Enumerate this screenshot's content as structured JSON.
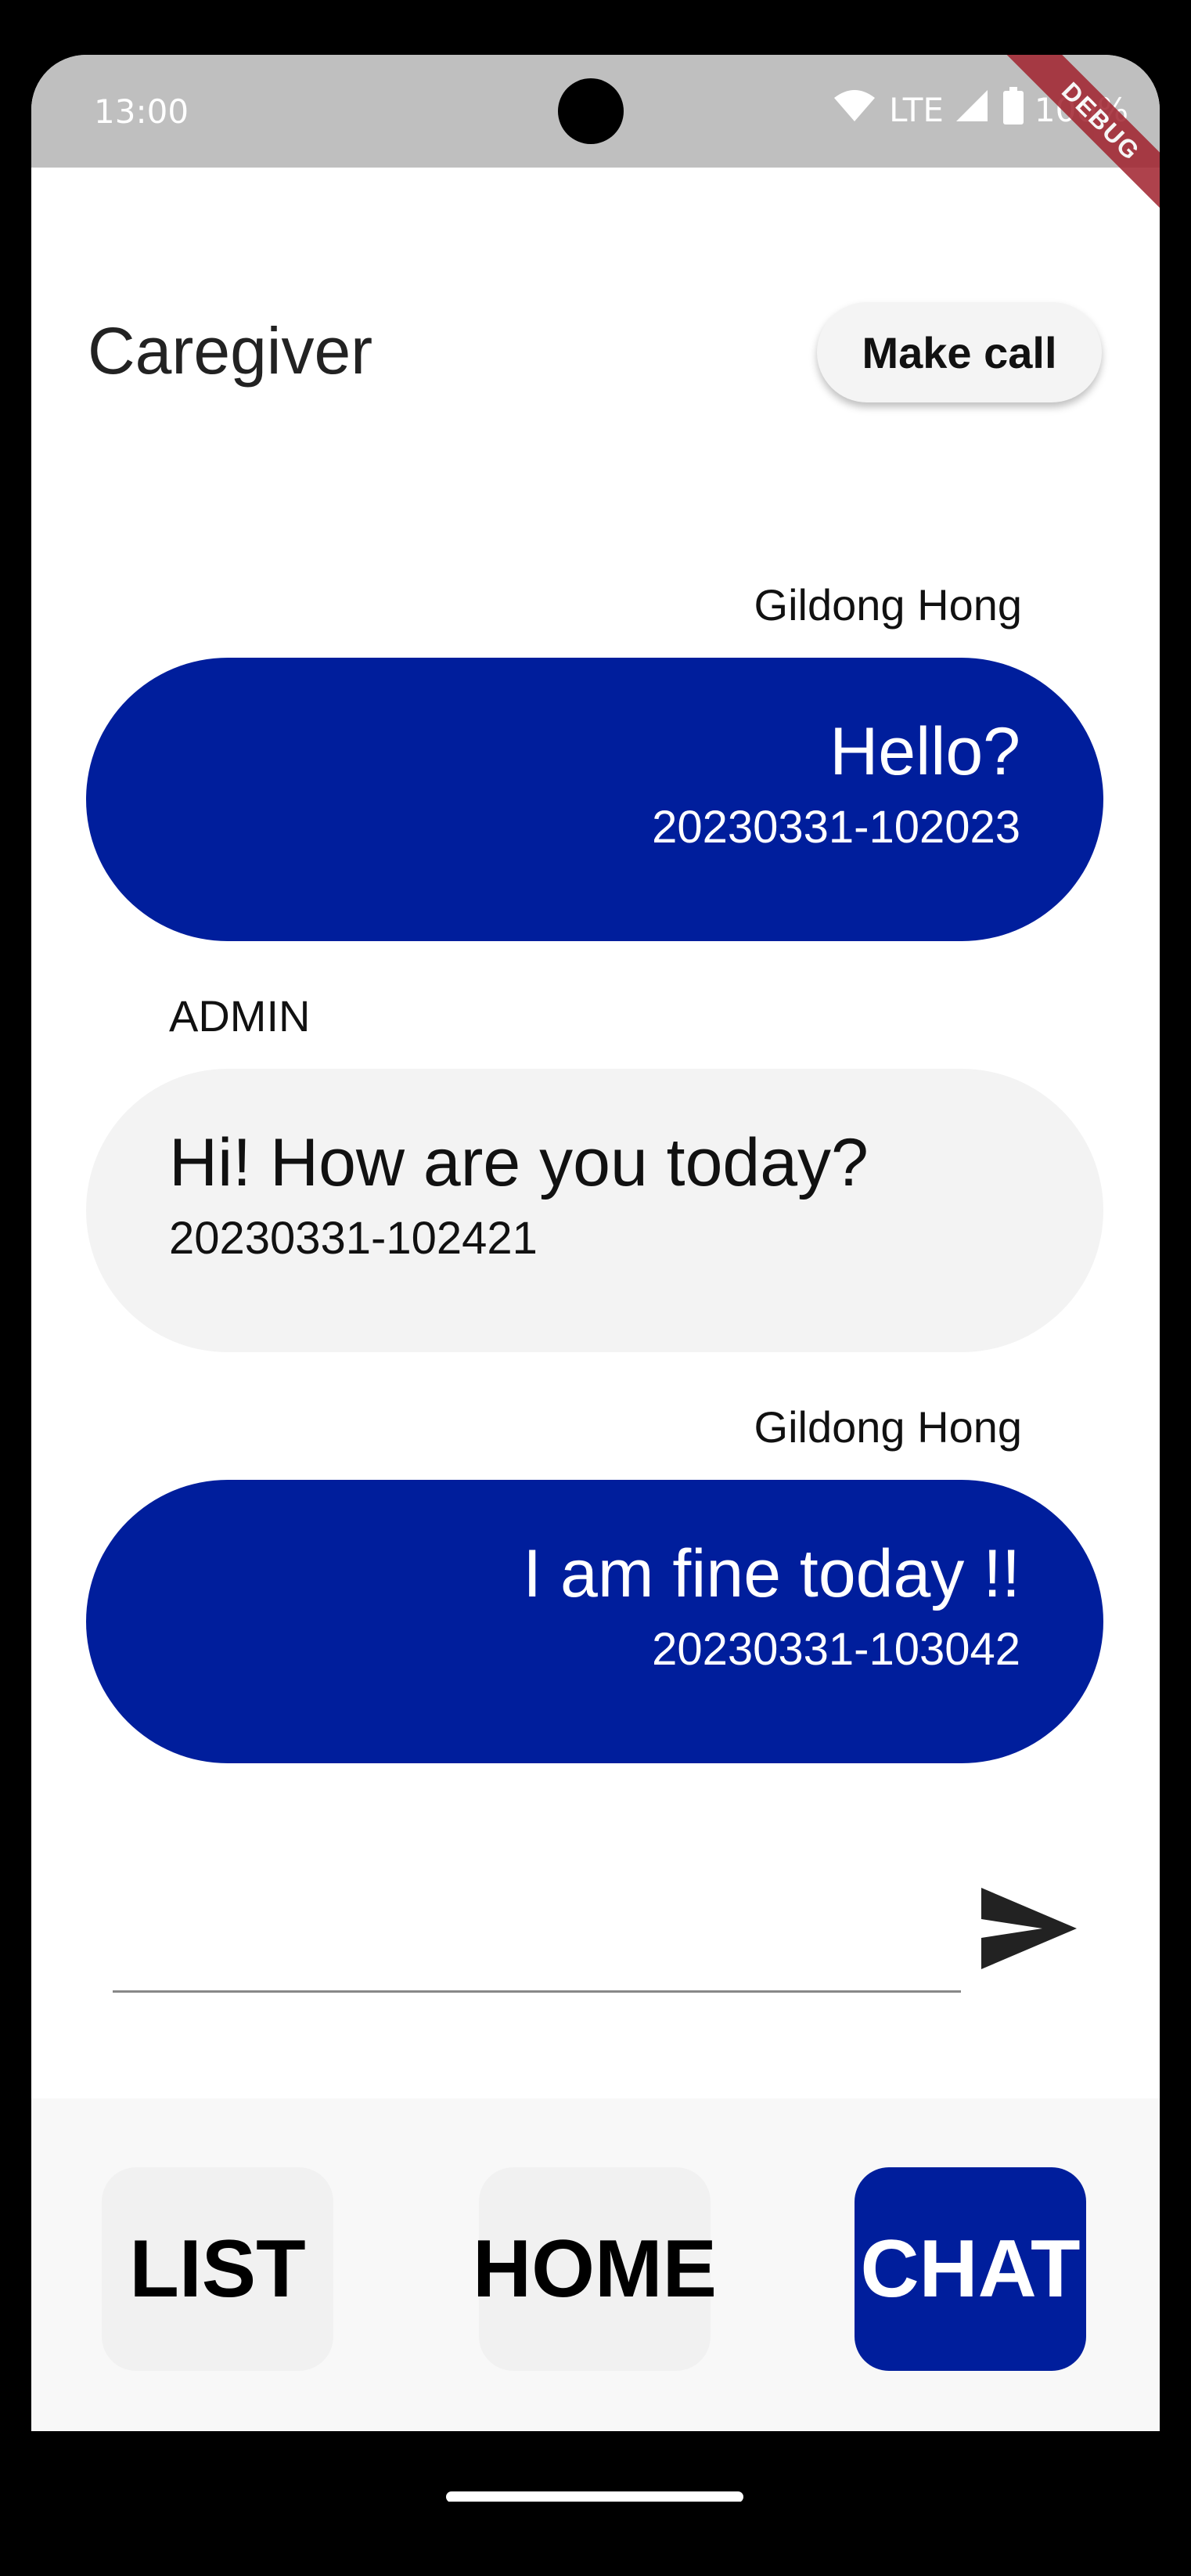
{
  "status_bar": {
    "time": "13:00",
    "network": "LTE",
    "battery": "100%",
    "debug_label": "DEBUG",
    "icons": [
      "wifi-icon",
      "signal-icon",
      "battery-icon"
    ]
  },
  "header": {
    "title": "Caregiver",
    "call_button_label": "Make call"
  },
  "messages": [
    {
      "sender": "Gildong Hong",
      "text": "Hello?",
      "timestamp": "20230331-102023",
      "side": "right"
    },
    {
      "sender": "ADMIN",
      "text": "Hi! How are you today?",
      "timestamp": "20230331-102421",
      "side": "left"
    },
    {
      "sender": "Gildong Hong",
      "text": "I am fine today !!",
      "timestamp": "20230331-103042",
      "side": "right"
    }
  ],
  "composer": {
    "value": "",
    "placeholder": "",
    "send_icon": "send-icon"
  },
  "bottom_nav": {
    "items": [
      {
        "label": "LIST",
        "active": false
      },
      {
        "label": "HOME",
        "active": false
      },
      {
        "label": "CHAT",
        "active": true
      }
    ]
  },
  "colors": {
    "accent": "#001e9c",
    "status_bar": "#bfbfbf",
    "incoming_bubble": "#f3f3f3"
  }
}
